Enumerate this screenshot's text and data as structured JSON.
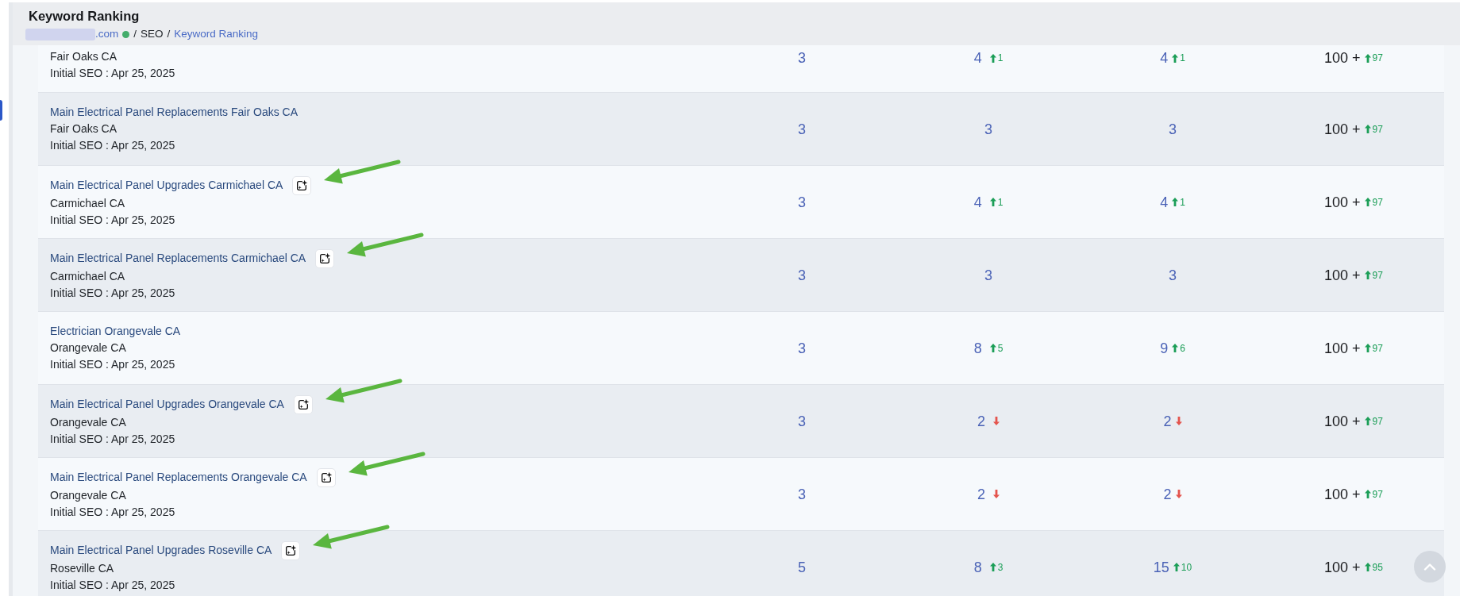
{
  "page": {
    "title": "Keyword Ranking"
  },
  "breadcrumb": [
    {
      "kind": "site",
      "text": ".com",
      "online": true
    },
    {
      "kind": "separator",
      "text": "/"
    },
    {
      "kind": "text",
      "text": "SEO"
    },
    {
      "kind": "separator",
      "text": "/"
    },
    {
      "kind": "link",
      "text": "Keyword Ranking"
    }
  ],
  "rows": [
    {
      "location": "Fair Oaks CA",
      "initial_seo": "Initial SEO : Apr 25, 2025",
      "ai_button": false,
      "arrow": false,
      "ranks": [
        {
          "kind": "plain",
          "value": "3"
        },
        {
          "kind": "up",
          "value": "4",
          "change": "1"
        },
        {
          "kind": "up",
          "value": "4",
          "change": "1"
        },
        {
          "kind": "up",
          "value": "100 +",
          "change": "97"
        }
      ]
    },
    {
      "keyword": "Main Electrical Panel Replacements Fair Oaks CA",
      "location": "Fair Oaks CA",
      "initial_seo": "Initial SEO : Apr 25, 2025",
      "ai_button": false,
      "arrow": false,
      "ranks": [
        {
          "kind": "plain",
          "value": "3"
        },
        {
          "kind": "plain",
          "value": "3"
        },
        {
          "kind": "plain",
          "value": "3"
        },
        {
          "kind": "up",
          "value": "100 +",
          "change": "97"
        }
      ]
    },
    {
      "keyword": "Main Electrical Panel Upgrades Carmichael CA",
      "location": "Carmichael CA",
      "initial_seo": "Initial SEO : Apr 25, 2025",
      "ai_button": true,
      "arrow": true,
      "ranks": [
        {
          "kind": "plain",
          "value": "3"
        },
        {
          "kind": "up",
          "value": "4",
          "change": "1"
        },
        {
          "kind": "up",
          "value": "4",
          "change": "1"
        },
        {
          "kind": "up",
          "value": "100 +",
          "change": "97"
        }
      ]
    },
    {
      "keyword": "Main Electrical Panel Replacements Carmichael CA",
      "location": "Carmichael CA",
      "initial_seo": "Initial SEO : Apr 25, 2025",
      "ai_button": true,
      "arrow": true,
      "ranks": [
        {
          "kind": "plain",
          "value": "3"
        },
        {
          "kind": "plain",
          "value": "3"
        },
        {
          "kind": "plain",
          "value": "3"
        },
        {
          "kind": "up",
          "value": "100 +",
          "change": "97"
        }
      ]
    },
    {
      "keyword": "Electrician Orangevale CA",
      "location": "Orangevale CA",
      "initial_seo": "Initial SEO : Apr 25, 2025",
      "ai_button": false,
      "arrow": false,
      "ranks": [
        {
          "kind": "plain",
          "value": "3"
        },
        {
          "kind": "up",
          "value": "8",
          "change": "5"
        },
        {
          "kind": "up",
          "value": "9",
          "change": "6"
        },
        {
          "kind": "up",
          "value": "100 +",
          "change": "97"
        }
      ]
    },
    {
      "keyword": "Main Electrical Panel Upgrades Orangevale CA",
      "location": "Orangevale CA",
      "initial_seo": "Initial SEO : Apr 25, 2025",
      "ai_button": true,
      "arrow": true,
      "ranks": [
        {
          "kind": "plain",
          "value": "3"
        },
        {
          "kind": "down",
          "value": "2"
        },
        {
          "kind": "down",
          "value": "2"
        },
        {
          "kind": "up",
          "value": "100 +",
          "change": "97"
        }
      ]
    },
    {
      "keyword": "Main Electrical Panel Replacements Orangevale CA",
      "location": "Orangevale CA",
      "initial_seo": "Initial SEO : Apr 25, 2025",
      "ai_button": true,
      "arrow": true,
      "ranks": [
        {
          "kind": "plain",
          "value": "3"
        },
        {
          "kind": "down",
          "value": "2"
        },
        {
          "kind": "down",
          "value": "2"
        },
        {
          "kind": "up",
          "value": "100 +",
          "change": "97"
        }
      ]
    },
    {
      "keyword": "Main Electrical Panel Upgrades Roseville CA",
      "location": "Roseville CA",
      "initial_seo": "Initial SEO : Apr 25, 2025",
      "ai_button": true,
      "arrow": true,
      "ranks": [
        {
          "kind": "plain",
          "value": "5"
        },
        {
          "kind": "up",
          "value": "8",
          "change": "3"
        },
        {
          "kind": "up",
          "value": "15",
          "change": "10"
        },
        {
          "kind": "up",
          "value": "100 +",
          "change": "95"
        }
      ]
    }
  ]
}
